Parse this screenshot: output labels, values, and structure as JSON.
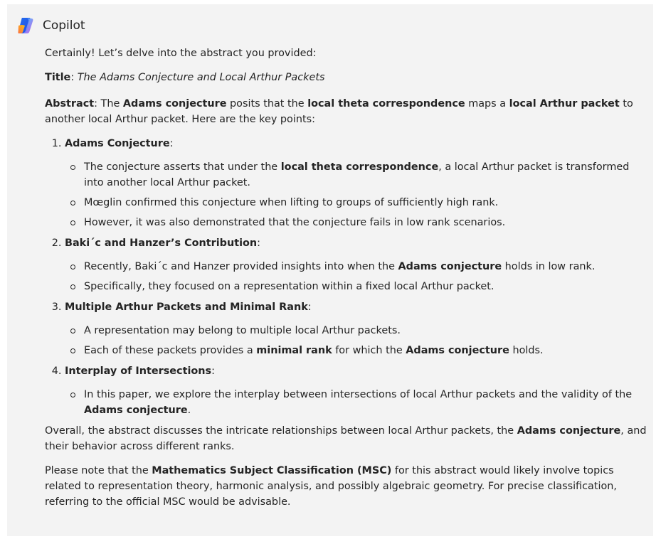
{
  "app": {
    "name": "Copilot",
    "logo_icon": "copilot-logo-icon"
  },
  "message": {
    "intro": "Certainly! Let’s delve into the abstract you provided:",
    "title_label": "Title",
    "title_sep": ": ",
    "title_value": "The Adams Conjecture and Local Arthur Packets",
    "abstract": {
      "label": "Abstract",
      "t1": ": The ",
      "b1": "Adams conjecture",
      "t2": " posits that the ",
      "b2": "local theta correspondence",
      "t3": " maps a ",
      "b3": "local Arthur packet",
      "t4": " to another local Arthur packet. Here are the key points:"
    },
    "points": [
      {
        "heading": "Adams Conjecture",
        "colon": ":",
        "bullets": {
          "b1": {
            "t1": "The conjecture asserts that under the ",
            "b1": "local theta correspondence",
            "t2": ", a local Arthur packet is transformed into another local Arthur packet."
          },
          "b2": {
            "t1": "Mœglin confirmed this conjecture when lifting to groups of sufficiently high rank."
          },
          "b3": {
            "t1": "However, it was also demonstrated that the conjecture fails in low rank scenarios."
          }
        }
      },
      {
        "heading": "Baki´c and Hanzer’s Contribution",
        "colon": ":",
        "bullets": {
          "b1": {
            "t1": "Recently, Baki´c and Hanzer provided insights into when the ",
            "b1": "Adams conjecture",
            "t2": " holds in low rank."
          },
          "b2": {
            "t1": "Specifically, they focused on a representation within a fixed local Arthur packet."
          }
        }
      },
      {
        "heading": "Multiple Arthur Packets and Minimal Rank",
        "colon": ":",
        "bullets": {
          "b1": {
            "t1": "A representation may belong to multiple local Arthur packets."
          },
          "b2": {
            "t1": "Each of these packets provides a ",
            "b1": "minimal rank",
            "t2": " for which the ",
            "b2": "Adams conjecture",
            "t3": " holds."
          }
        }
      },
      {
        "heading": "Interplay of Intersections",
        "colon": ":",
        "bullets": {
          "b1": {
            "t1": "In this paper, we explore the interplay between intersections of local Arthur packets and the validity of the ",
            "b1": "Adams conjecture",
            "t2": "."
          }
        }
      }
    ],
    "overall": {
      "t1": "Overall, the abstract discusses the intricate relationships between local Arthur packets, the ",
      "b1": "Adams conjecture",
      "t2": ", and their behavior across different ranks."
    },
    "note": {
      "t1": "Please note that the ",
      "b1": "Mathematics Subject Classification (MSC)",
      "t2": " for this abstract would likely involve topics related to representation theory, harmonic analysis, and possibly algebraic geometry. For precise classification, referring to the official MSC would be advisable."
    }
  }
}
